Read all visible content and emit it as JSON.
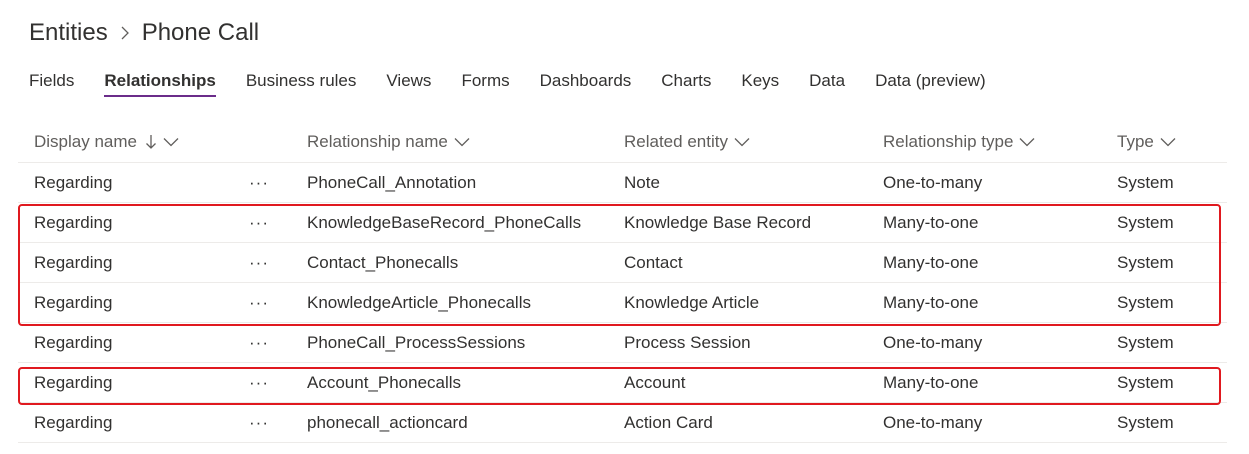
{
  "breadcrumb": {
    "parent": "Entities",
    "current": "Phone Call"
  },
  "tabs": [
    {
      "label": "Fields",
      "active": false
    },
    {
      "label": "Relationships",
      "active": true
    },
    {
      "label": "Business rules",
      "active": false
    },
    {
      "label": "Views",
      "active": false
    },
    {
      "label": "Forms",
      "active": false
    },
    {
      "label": "Dashboards",
      "active": false
    },
    {
      "label": "Charts",
      "active": false
    },
    {
      "label": "Keys",
      "active": false
    },
    {
      "label": "Data",
      "active": false
    },
    {
      "label": "Data (preview)",
      "active": false
    }
  ],
  "columns": {
    "display_name": "Display name",
    "relationship_name": "Relationship name",
    "related_entity": "Related entity",
    "relationship_type": "Relationship type",
    "type": "Type"
  },
  "row_menu": "···",
  "rows": [
    {
      "display_name": "Regarding",
      "relationship_name": "PhoneCall_Annotation",
      "related_entity": "Note",
      "relationship_type": "One-to-many",
      "type": "System"
    },
    {
      "display_name": "Regarding",
      "relationship_name": "KnowledgeBaseRecord_PhoneCalls",
      "related_entity": "Knowledge Base Record",
      "relationship_type": "Many-to-one",
      "type": "System"
    },
    {
      "display_name": "Regarding",
      "relationship_name": "Contact_Phonecalls",
      "related_entity": "Contact",
      "relationship_type": "Many-to-one",
      "type": "System"
    },
    {
      "display_name": "Regarding",
      "relationship_name": "KnowledgeArticle_Phonecalls",
      "related_entity": "Knowledge Article",
      "relationship_type": "Many-to-one",
      "type": "System"
    },
    {
      "display_name": "Regarding",
      "relationship_name": "PhoneCall_ProcessSessions",
      "related_entity": "Process Session",
      "relationship_type": "One-to-many",
      "type": "System"
    },
    {
      "display_name": "Regarding",
      "relationship_name": "Account_Phonecalls",
      "related_entity": "Account",
      "relationship_type": "Many-to-one",
      "type": "System"
    },
    {
      "display_name": "Regarding",
      "relationship_name": "phonecall_actioncard",
      "related_entity": "Action Card",
      "relationship_type": "One-to-many",
      "type": "System"
    }
  ],
  "highlight_color": "#e0191f",
  "accent_color": "#6b2c8a"
}
